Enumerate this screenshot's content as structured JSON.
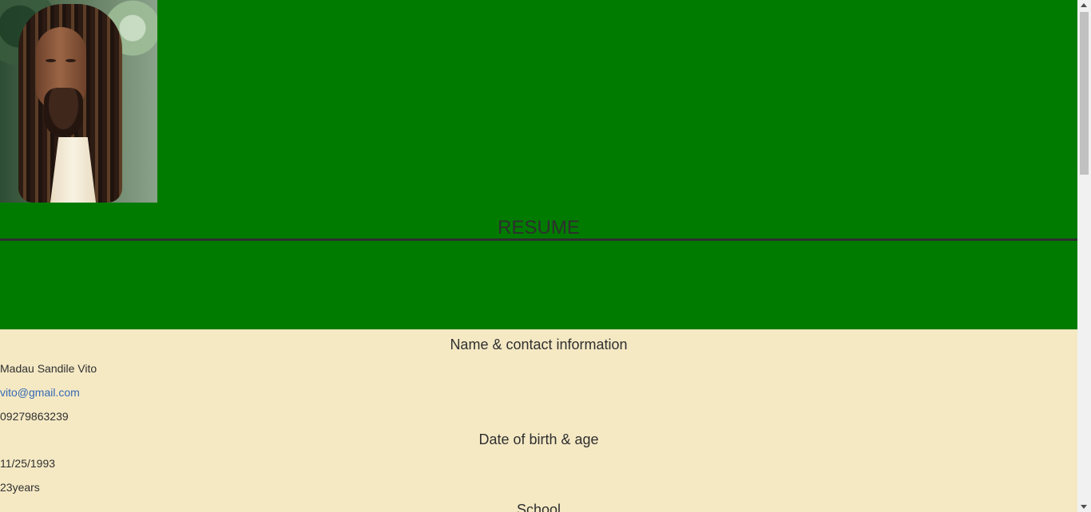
{
  "page": {
    "header": {
      "title": "RESUME",
      "band_color": "#007b00",
      "photo_icon": "profile-photo"
    },
    "contact": {
      "heading": "Name & contact information",
      "name": "Madau Sandile Vito",
      "email": "vito@gmail.com",
      "phone": "09279863239"
    },
    "birth": {
      "heading": "Date of birth & age",
      "date": "11/25/1993",
      "age": "23years"
    },
    "school": {
      "heading": "School"
    },
    "colors": {
      "content_background": "#f5e9c4",
      "text": "#2f2f2f",
      "link": "#3569b3",
      "scrollbar": "#f1f1f1"
    }
  }
}
